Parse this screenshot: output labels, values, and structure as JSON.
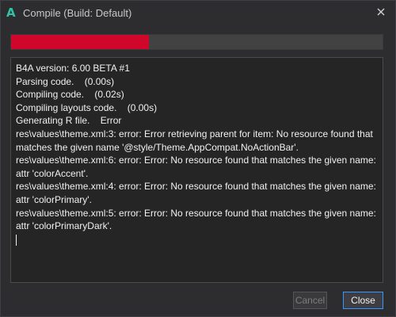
{
  "window": {
    "title": "Compile (Build: Default)",
    "app_icon_glyph": "A",
    "app_icon_name": "b4a-app-icon",
    "close_icon_name": "close-icon",
    "accent_color": "#2ec4a6"
  },
  "progress": {
    "value_fraction": 0.37,
    "fill_color": "#d0062a"
  },
  "output": {
    "lines": [
      "B4A version: 6.00 BETA #1",
      "Parsing code.    (0.00s)",
      "Compiling code.    (0.02s)",
      "Compiling layouts code.    (0.00s)",
      "Generating R file.    Error",
      "res\\values\\theme.xml:3: error: Error retrieving parent for item: No resource found that",
      "matches the given name '@style/Theme.AppCompat.NoActionBar'.",
      "res\\values\\theme.xml:6: error: Error: No resource found that matches the given name:",
      "attr 'colorAccent'.",
      "res\\values\\theme.xml:4: error: Error: No resource found that matches the given name:",
      "attr 'colorPrimary'.",
      "res\\values\\theme.xml:5: error: Error: No resource found that matches the given name:",
      "attr 'colorPrimaryDark'."
    ]
  },
  "buttons": {
    "cancel_label": "Cancel",
    "cancel_enabled": false,
    "close_label": "Close"
  }
}
